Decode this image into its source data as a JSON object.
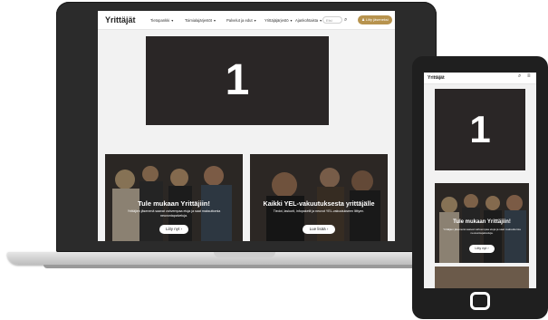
{
  "laptop": {
    "header": {
      "logo": "Yrittäjät",
      "nav": [
        {
          "label": "Tietopankki"
        },
        {
          "label": "Toimialajärjestöt"
        },
        {
          "label": "Palvelut ja edut"
        },
        {
          "label": "Yrittäjäjärjestö"
        },
        {
          "label": "Ajankohtaista"
        }
      ],
      "search_placeholder": "Etsi",
      "join_label": "Liity jäseneksi"
    },
    "hero": {
      "text": "1"
    },
    "cards": [
      {
        "title": "Tule mukaan Yrittäjiin!",
        "desc": "Yrittäjien jäsenenä saavat vahvempaa etuja ja saat maksuttomia neuvontapalveluja.",
        "button": "Liity nyt"
      },
      {
        "title": "Kaikki YEL-vakuutuksesta yrittäjälle",
        "desc": "Tiedot, laskurit, infopaketit ja neuvot YEL-vakuutukseen liittyen.",
        "button": "Lue lisää"
      }
    ]
  },
  "phone": {
    "header": {
      "logo": "Yrittäjät"
    },
    "hero": {
      "text": "1"
    },
    "card": {
      "title": "Tule mukaan Yrittäjiin!",
      "desc": "Yrittäjien jäsenenä saavat vahvempaa etuja ja saat maksuttomia neuvontapalveluja.",
      "button": "Liity nyt"
    }
  },
  "colors": {
    "accent": "#b7934e",
    "hero_bg": "#2a2626",
    "device": "#2b2b2b"
  },
  "icons": {
    "search": "search-icon",
    "menu": "hamburger-icon",
    "arrow": "arrow-right-icon"
  }
}
